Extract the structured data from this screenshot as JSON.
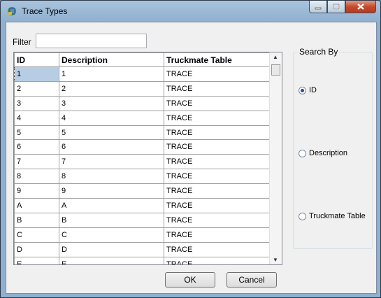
{
  "window": {
    "title": "Trace Types"
  },
  "filter": {
    "label": "Filter",
    "value": ""
  },
  "table": {
    "columns": [
      "ID",
      "Description",
      "Truckmate Table"
    ],
    "rows": [
      [
        "1",
        "1",
        "TRACE"
      ],
      [
        "2",
        "2",
        "TRACE"
      ],
      [
        "3",
        "3",
        "TRACE"
      ],
      [
        "4",
        "4",
        "TRACE"
      ],
      [
        "5",
        "5",
        "TRACE"
      ],
      [
        "6",
        "6",
        "TRACE"
      ],
      [
        "7",
        "7",
        "TRACE"
      ],
      [
        "8",
        "8",
        "TRACE"
      ],
      [
        "9",
        "9",
        "TRACE"
      ],
      [
        "A",
        "A",
        "TRACE"
      ],
      [
        "B",
        "B",
        "TRACE"
      ],
      [
        "C",
        "C",
        "TRACE"
      ],
      [
        "D",
        "D",
        "TRACE"
      ],
      [
        "E",
        "E",
        "TRACE"
      ]
    ],
    "selected_row": 0
  },
  "search_by": {
    "label": "Search By",
    "options": [
      "ID",
      "Description",
      "Truckmate Table"
    ],
    "selected": "ID"
  },
  "buttons": {
    "ok": "OK",
    "cancel": "Cancel"
  },
  "icons": {
    "app": "trace-types-app-icon",
    "minimize": "minimize-icon",
    "maximize": "maximize-icon",
    "close": "close-icon"
  }
}
